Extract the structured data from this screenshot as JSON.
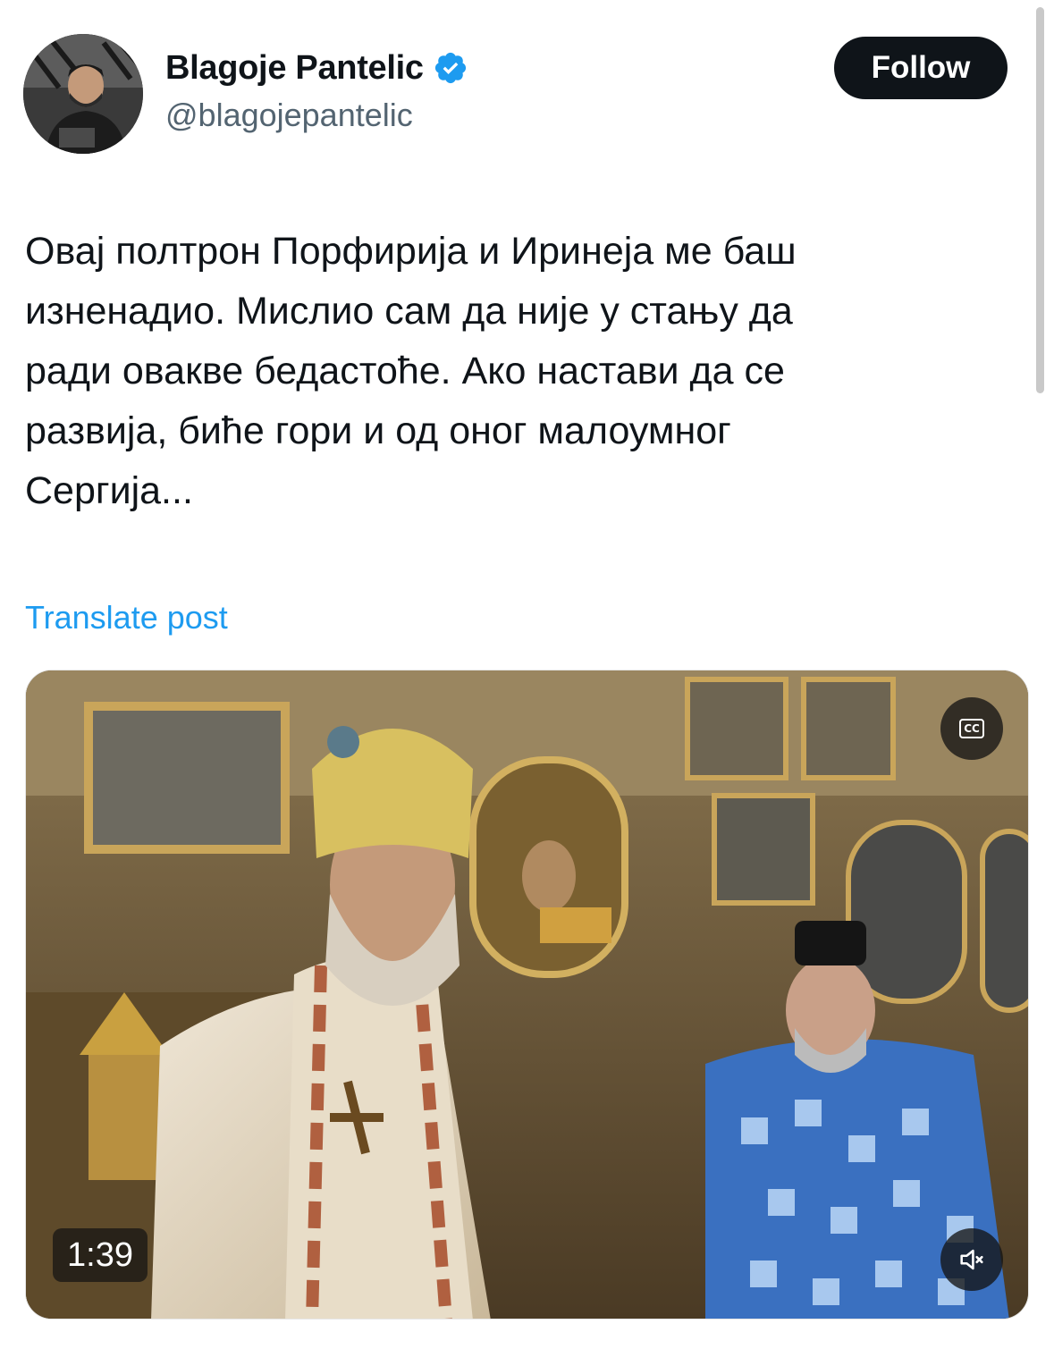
{
  "user": {
    "name": "Blagoje Pantelic",
    "handle": "@blagojepantelic",
    "verified": true,
    "avatar_icon": "profile-photo"
  },
  "follow_label": "Follow",
  "post": {
    "lines": [
      "Овај полтрон Порфирија и Иринеја ме баш",
      "изненадио. Мислио сам да није у стању да",
      "ради овакве бедастоће. Ако настави да се",
      "развија, биће гори и од оног малоумног",
      "Сергија..."
    ]
  },
  "translate_label": "Translate post",
  "video": {
    "duration": "1:39",
    "cc_icon": "closed-captions-icon",
    "mute_icon": "volume-muted-icon",
    "cc_label": "CC"
  },
  "colors": {
    "accent": "#1d9bf0",
    "text": "#0f1419",
    "secondary": "#536471",
    "button_bg": "#0f1419"
  }
}
